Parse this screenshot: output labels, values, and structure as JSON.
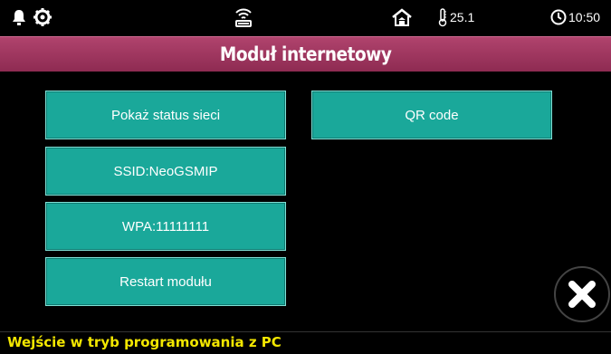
{
  "status_bar": {
    "icons": [
      "bell-icon",
      "gear-icon",
      "wifi-router-icon",
      "home-alarm-icon",
      "thermometer-icon",
      "clock-icon"
    ],
    "temperature": "25.1",
    "time": "10:50"
  },
  "header": {
    "title": "Moduł internetowy"
  },
  "buttons": {
    "show_network_status": "Pokaż status sieci",
    "ssid": "SSID:NeoGSMIP",
    "wpa": "WPA:11111111",
    "restart_module": "Restart modułu",
    "qr_code": "QR code"
  },
  "footer": {
    "message": "Wejście w tryb programowania z PC"
  },
  "colors": {
    "accent": "#1aa89a",
    "title_bar": "#9e3560",
    "footer_text": "#f2e600"
  }
}
